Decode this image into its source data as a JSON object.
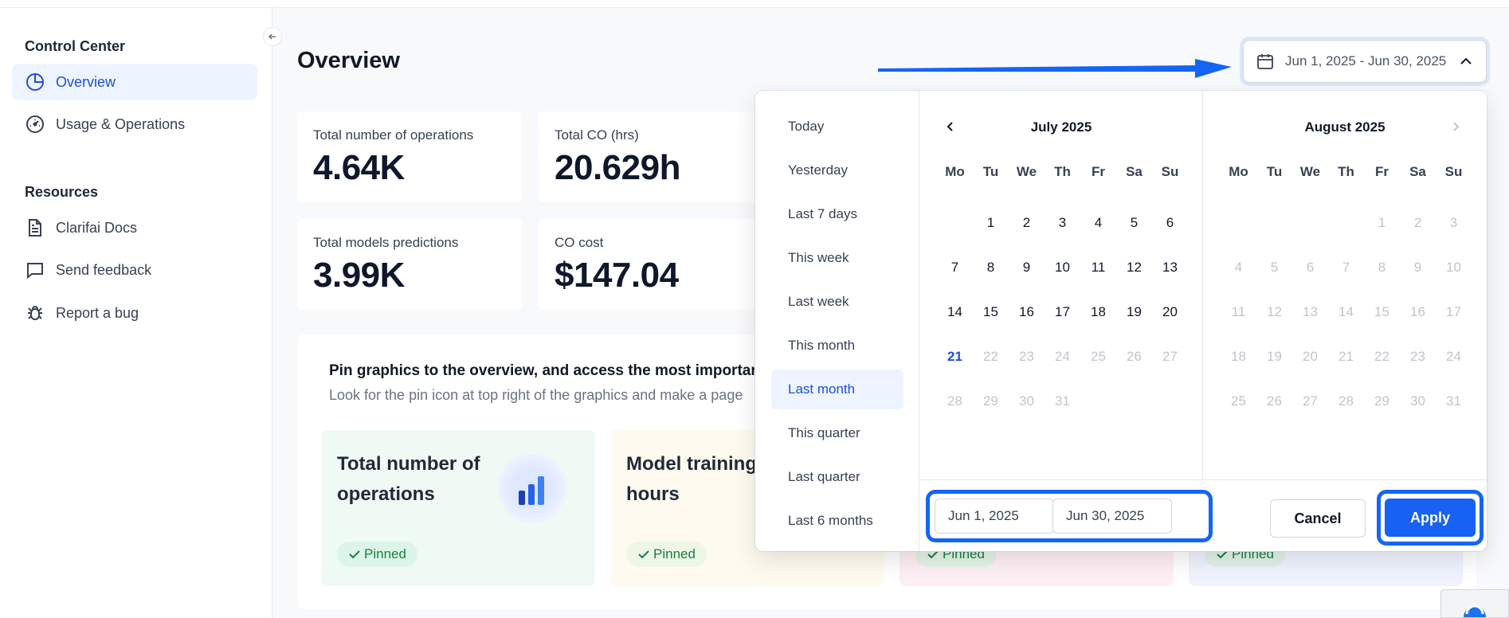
{
  "sidebar": {
    "control_heading": "Control Center",
    "items": [
      {
        "label": "Overview",
        "icon": "pie-chart-icon"
      },
      {
        "label": "Usage & Operations",
        "icon": "gauge-icon"
      }
    ],
    "resources_heading": "Resources",
    "resources": [
      {
        "label": "Clarifai Docs",
        "icon": "document-icon"
      },
      {
        "label": "Send feedback",
        "icon": "message-icon"
      },
      {
        "label": "Report a bug",
        "icon": "bug-icon"
      }
    ]
  },
  "main": {
    "title": "Overview",
    "stats": [
      {
        "label": "Total number of operations",
        "value": "4.64K"
      },
      {
        "label": "Total CO (hrs)",
        "value": "20.629h"
      },
      {
        "label": "Total models predictions",
        "value": "3.99K"
      },
      {
        "label": "CO cost",
        "value": "$147.04"
      }
    ],
    "pin_panel": {
      "title": "Pin graphics to the overview, and access the most importan",
      "subtitle": "Look for the pin icon at top right of the graphics and make a page",
      "cards": [
        {
          "title": "Total number of operations",
          "pin": "Pinned",
          "color": "#effaf5"
        },
        {
          "title": "Model training hours",
          "pin": "Pinned",
          "color": "#fefaef"
        },
        {
          "title": "",
          "pin": "Pinned",
          "color": "#fdeff4"
        },
        {
          "title": "",
          "pin": "Pinned",
          "color": "#f0f3fd"
        }
      ]
    }
  },
  "date_button": {
    "label": "Jun 1, 2025 - Jun 30, 2025",
    "icon": "calendar-icon"
  },
  "picker": {
    "presets": [
      "Today",
      "Yesterday",
      "Last 7 days",
      "This week",
      "Last week",
      "This month",
      "Last month",
      "This quarter",
      "Last quarter",
      "Last 6 months"
    ],
    "active_preset": "Last month",
    "weekdays": [
      "Mo",
      "Tu",
      "We",
      "Th",
      "Fr",
      "Sa",
      "Su"
    ],
    "left_month": "July 2025",
    "right_month": "August 2025",
    "start_input": "Jun 1, 2025",
    "end_input": "Jun 30, 2025",
    "separator": "-",
    "cancel_label": "Cancel",
    "apply_label": "Apply",
    "accent": "#1762f3"
  }
}
